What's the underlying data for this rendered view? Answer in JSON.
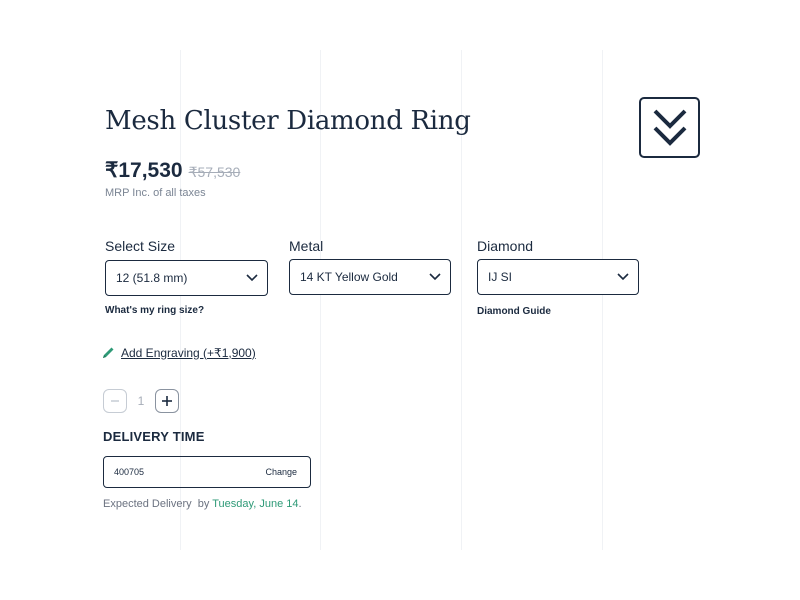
{
  "product": {
    "title": "Mesh Cluster Diamond Ring",
    "price": "₹17,530",
    "original_price": "₹57,530",
    "tax_note": "MRP Inc. of all taxes"
  },
  "options": {
    "size": {
      "label": "Select Size",
      "value": "12 (51.8 mm)",
      "helper": "What's my ring size?"
    },
    "metal": {
      "label": "Metal",
      "value": "14 KT Yellow Gold"
    },
    "diamond": {
      "label": "Diamond",
      "value": "IJ SI",
      "helper": "Diamond Guide"
    }
  },
  "engraving": {
    "label": "Add Engraving (+₹1,900)",
    "icon": "pencil-icon"
  },
  "quantity": {
    "value": "1"
  },
  "delivery": {
    "heading": "DELIVERY TIME",
    "pincode": "400705",
    "change_label": "Change",
    "expected_prefix": "Expected Delivery  by",
    "expected_date": "Tuesday, June 14",
    "expected_suffix": "."
  },
  "colors": {
    "navy": "#1b2a3f",
    "green_accent": "#2e9a77",
    "muted": "#a6adb8"
  }
}
